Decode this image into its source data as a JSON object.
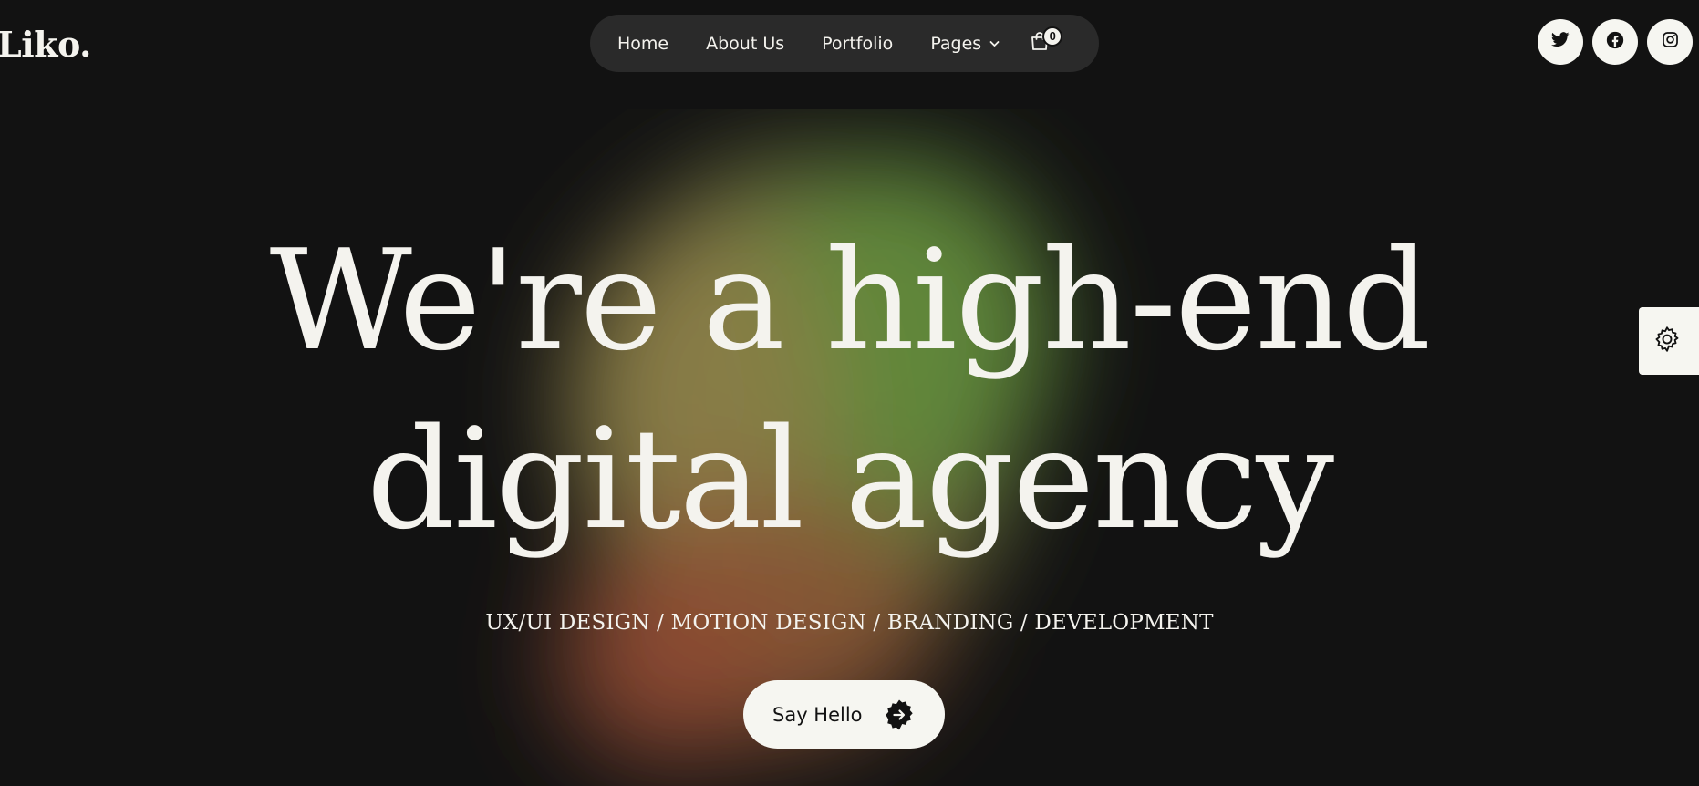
{
  "brand": {
    "logo_text": "Liko."
  },
  "nav": {
    "items": [
      {
        "label": "Home"
      },
      {
        "label": "About Us"
      },
      {
        "label": "Portfolio"
      },
      {
        "label": "Pages",
        "has_dropdown": true
      }
    ],
    "cart_count": "0"
  },
  "social": [
    "twitter-icon",
    "facebook-icon",
    "instagram-icon"
  ],
  "hero": {
    "headline_line1": "We're a high-end",
    "headline_line2": "digital agency",
    "services": "UX/UI DESIGN / MOTION DESIGN / BRANDING / DEVELOPMENT",
    "cta_label": "Say Hello"
  },
  "colors": {
    "background": "#121212",
    "text": "#f4f3ee",
    "nav_pill": "#2a2a2a",
    "button": "#f6f6f1",
    "glow_green": "#6a8a3c",
    "glow_olive": "#8a7a45",
    "glow_rust": "#8a4a30"
  }
}
